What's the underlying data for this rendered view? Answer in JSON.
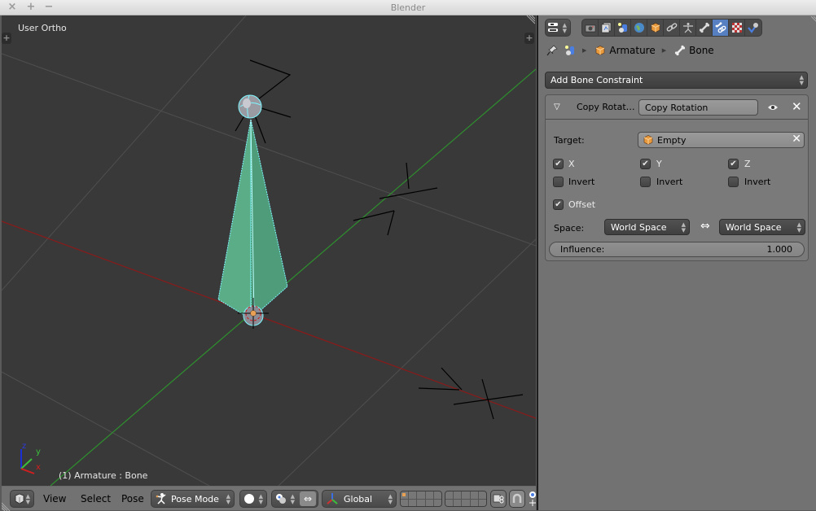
{
  "window": {
    "title": "Blender",
    "buttons": {
      "close": "×",
      "maximize": "+",
      "minimize": "−"
    }
  },
  "viewport": {
    "view_label": "User Ortho",
    "object_info": "(1) Armature : Bone",
    "axis_labels": {
      "x": "x",
      "y": "y",
      "z": "z"
    },
    "colors": {
      "background": "#393939",
      "x_axis": "#8b1a1a",
      "y_axis": "#2b8a2b",
      "grid": "#4d4d4d",
      "bone_fill": "#58a882",
      "bone_outline": "#7ff7ff"
    }
  },
  "viewport_header": {
    "editor_type_icon": "cube-icon",
    "menus": [
      "View",
      "Select",
      "Pose"
    ],
    "mode": {
      "label": "Pose Mode",
      "icon": "pose-icon"
    },
    "shading_icon": "sphere-solid-icon",
    "pivot_icon": "pivot-icon",
    "manipulator_icon": "manipulator-icon",
    "orientation": {
      "label": "Global",
      "icon": "transform-axes-icon"
    },
    "layers_active_index": 0,
    "lock_icon": "lock-camera-icon",
    "snap_icon": "magnet-icon",
    "extra_icon": "proportional-edit-icon"
  },
  "properties": {
    "context_tabs": [
      {
        "name": "render",
        "icon": "camera-icon"
      },
      {
        "name": "render-layers",
        "icon": "render-layers-icon"
      },
      {
        "name": "scene",
        "icon": "scene-icon"
      },
      {
        "name": "world",
        "icon": "world-icon"
      },
      {
        "name": "object",
        "icon": "object-cube-icon"
      },
      {
        "name": "constraints",
        "icon": "chain-link-icon"
      },
      {
        "name": "data",
        "icon": "armature-figure-icon"
      },
      {
        "name": "bone",
        "icon": "bone-icon"
      },
      {
        "name": "bone-constraints",
        "icon": "bone-constraint-icon",
        "active": true
      },
      {
        "name": "texture",
        "icon": "checker-texture-icon"
      },
      {
        "name": "physics",
        "icon": "physics-icon"
      }
    ],
    "breadcrumbs": [
      {
        "label": "",
        "icon": "scene-icon"
      },
      {
        "label": "Armature",
        "icon": "object-cube-icon"
      },
      {
        "label": "Bone",
        "icon": "bone-icon"
      }
    ],
    "add_constraint_label": "Add Bone Constraint",
    "constraint": {
      "type_label": "Copy Rotat…",
      "name": "Copy Rotation",
      "target_label": "Target:",
      "target_value": "Empty",
      "axes": [
        {
          "label": "X",
          "checked": true,
          "invert_label": "Invert",
          "invert": false
        },
        {
          "label": "Y",
          "checked": true,
          "invert_label": "Invert",
          "invert": false
        },
        {
          "label": "Z",
          "checked": true,
          "invert_label": "Invert",
          "invert": false
        }
      ],
      "offset_label": "Offset",
      "offset": true,
      "space_label": "Space:",
      "owner_space": "World Space",
      "target_space": "World Space",
      "space_arrow": "⇔",
      "influence_label": "Influence:",
      "influence_value": "1.000"
    }
  }
}
